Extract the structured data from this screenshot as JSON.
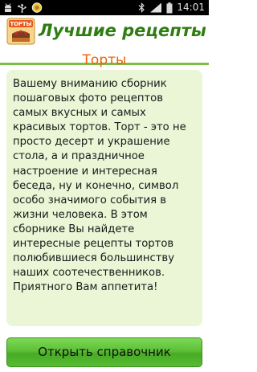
{
  "status_bar": {
    "time": "14:01",
    "left_icons": [
      "android-debug-icon",
      "usb-icon",
      "recipe-app-notification-icon"
    ],
    "right_icons": [
      "bluetooth-icon",
      "signal-icon",
      "battery-icon"
    ]
  },
  "header": {
    "logo_text": "ТОРТЫ",
    "title": "Лучшие рецепты"
  },
  "page": {
    "heading": "Торты",
    "description": "Вашему вниманию сборник пошаговых фото рецептов самых вкусных и самых красивых тортов. Торт - это не просто десерт и украшение стола, а и праздничное настроение и интересная беседа, ну и конечно, символ особо значимого события в жизни человека. В этом сборнике Вы найдете интересные рецепты тортов полюбившиеся большинству наших соотечественников. Приятного Вам аппетита!"
  },
  "actions": {
    "open_label": "Открыть справочник"
  },
  "colors": {
    "title_green": "#2f7d12",
    "accent_green": "#7ac143",
    "heading_orange": "#f0620a",
    "card_background": "#eaf6d6",
    "button_green": "#5cbf36"
  }
}
